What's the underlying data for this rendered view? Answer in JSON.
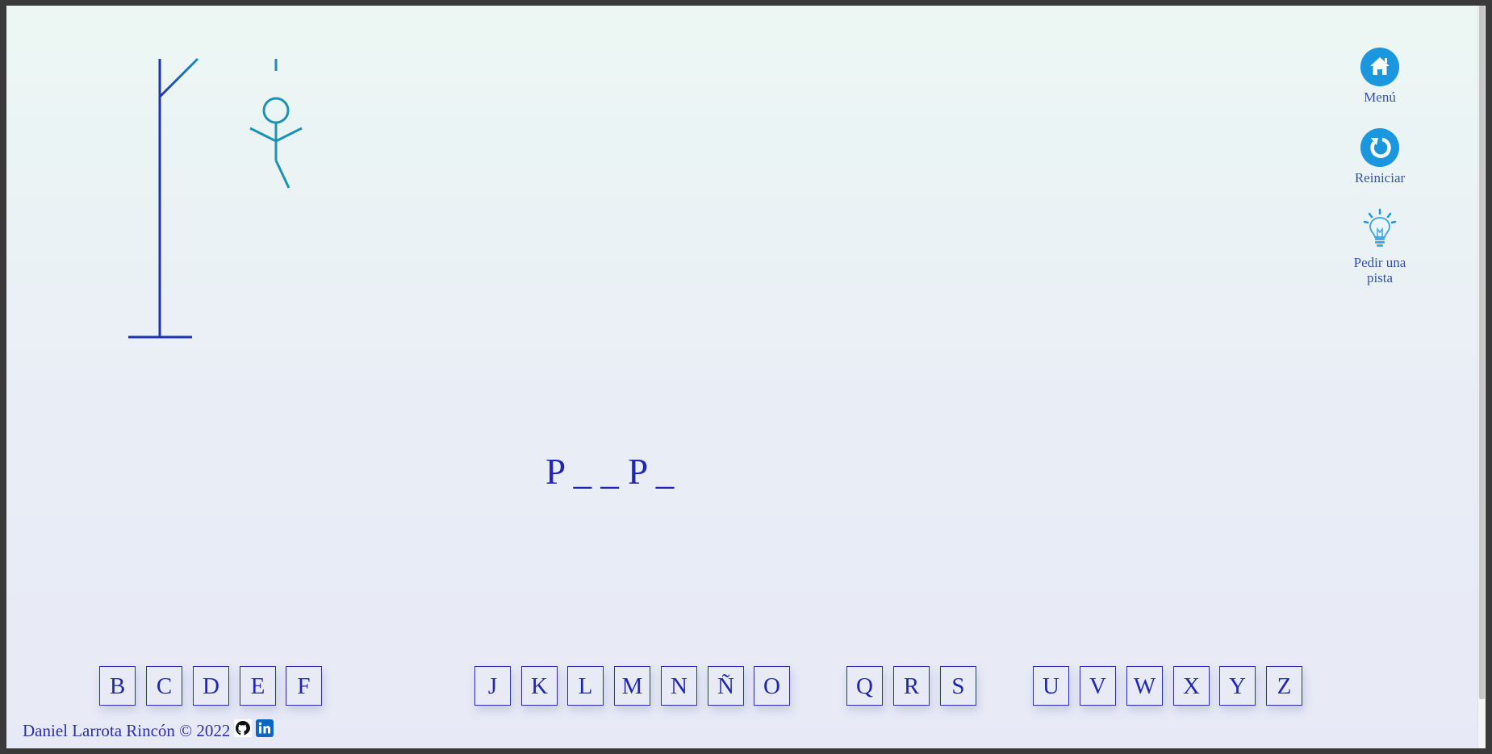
{
  "game": {
    "mistakes": 4,
    "word_display": "P _ _ P _"
  },
  "sidebar": {
    "menu_label": "Menú",
    "menu_icon": "home-icon",
    "reset_label": "Reiniciar",
    "reset_icon": "restart-icon",
    "hint_label_line1": "Pedir una",
    "hint_label_line2": "pista",
    "hint_icon": "lightbulb-icon"
  },
  "keyboard": {
    "letters": [
      "B",
      "C",
      "D",
      "E",
      "F",
      "J",
      "K",
      "L",
      "M",
      "N",
      "Ñ",
      "O",
      "Q",
      "R",
      "S",
      "U",
      "V",
      "W",
      "X",
      "Y",
      "Z"
    ]
  },
  "footer": {
    "credit": "Daniel Larrota Rincón © 2022",
    "github_icon": "github-icon",
    "linkedin_icon": "linkedin-icon"
  },
  "colors": {
    "accent": "#1b97e0",
    "text": "#2126b8",
    "gallows": "#1a3fb0",
    "figure": "#1b93b3"
  }
}
